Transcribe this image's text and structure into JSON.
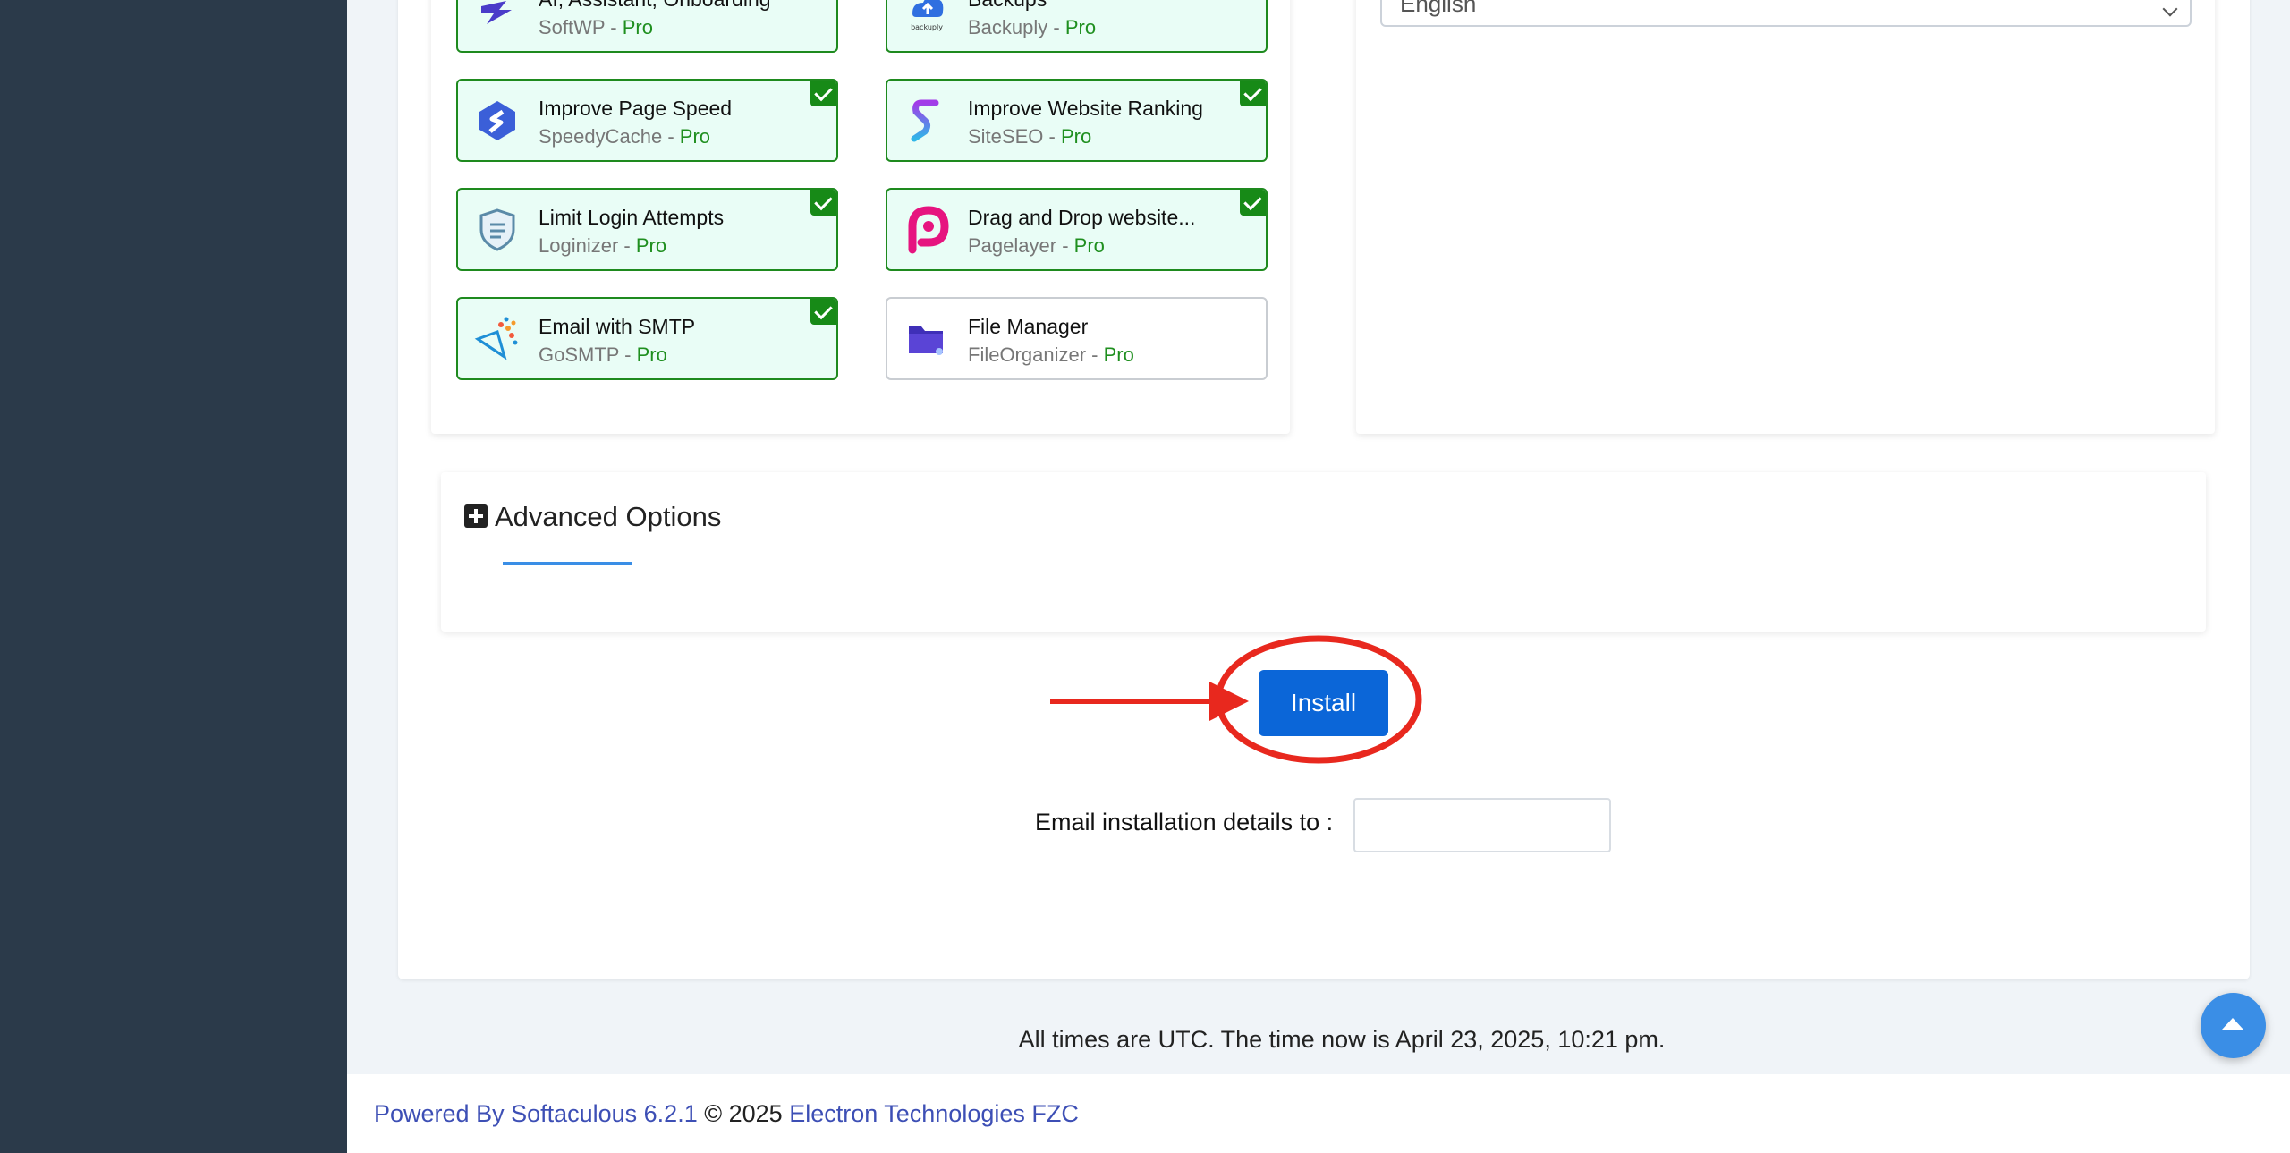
{
  "plugins": [
    {
      "title": "AI, Assistant, Onboarding",
      "vendor": "SoftWP",
      "tier": "Pro",
      "checked": true,
      "icon": "softwp-icon"
    },
    {
      "title": "Backups",
      "vendor": "Backuply",
      "tier": "Pro",
      "checked": true,
      "icon": "backuply-icon",
      "icon_caption": "backuply"
    },
    {
      "title": "Improve Page Speed",
      "vendor": "SpeedyCache",
      "tier": "Pro",
      "checked": true,
      "icon": "speedycache-icon"
    },
    {
      "title": "Improve Website Ranking",
      "vendor": "SiteSEO",
      "tier": "Pro",
      "checked": true,
      "icon": "siteseo-icon"
    },
    {
      "title": "Limit Login Attempts",
      "vendor": "Loginizer",
      "tier": "Pro",
      "checked": true,
      "icon": "loginizer-shield-icon"
    },
    {
      "title": "Drag and Drop website...",
      "vendor": "Pagelayer",
      "tier": "Pro",
      "checked": true,
      "icon": "pagelayer-icon"
    },
    {
      "title": "Email with SMTP",
      "vendor": "GoSMTP",
      "tier": "Pro",
      "checked": true,
      "icon": "gosmtp-icon"
    },
    {
      "title": "File Manager",
      "vendor": "FileOrganizer",
      "tier": "Pro",
      "checked": false,
      "icon": "fileorganizer-folder-icon"
    }
  ],
  "language": {
    "selected": "English"
  },
  "advanced": {
    "title": "Advanced Options"
  },
  "install": {
    "label": "Install"
  },
  "email": {
    "label": "Email installation details to :",
    "value": ""
  },
  "timezone_note": "All times are UTC. The time now is April 23, 2025, 10:21 pm.",
  "footer": {
    "powered_by": "Powered By Softaculous 6.2.1",
    "copyright": " © 2025 ",
    "company": "Electron Technologies FZC"
  },
  "colors": {
    "sidebar": "#2b3a4a",
    "accent": "#0b66d8",
    "pro_green": "#1f8f1f",
    "annotation_red": "#e8281e"
  }
}
